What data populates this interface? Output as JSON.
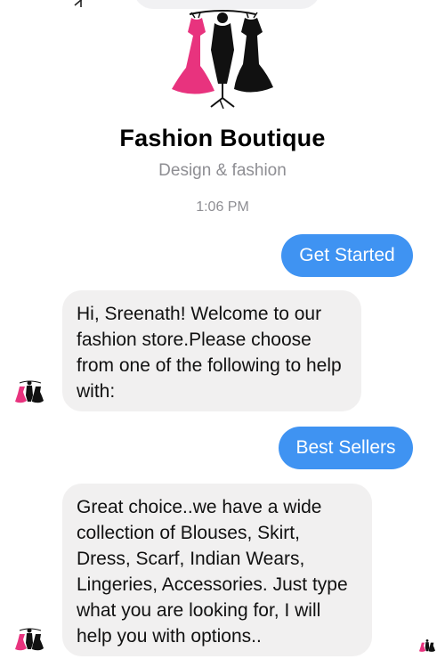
{
  "header": {
    "title": "Fashion Boutique",
    "subtitle": "Design & fashion"
  },
  "timestamp": "1:06 PM",
  "messages": [
    {
      "from": "user",
      "text": "Get Started"
    },
    {
      "from": "bot",
      "text": "Hi, Sreenath! Welcome to our fashion store.Please choose from one of the following to help with:"
    },
    {
      "from": "user",
      "text": "Best Sellers"
    },
    {
      "from": "bot",
      "text": "Great choice..we have a wide collection of Blouses, Skirt, Dress, Scarf, Indian Wears, Lingeries, Accessories. Just type what you are looking for, I will help you with options.."
    }
  ],
  "icons": {
    "brand_logo": "boutique-dress-logo",
    "bot_avatar": "boutique-dress-avatar",
    "seen_receipt": "boutique-dress-avatar"
  },
  "colors": {
    "outgoing_bubble": "#3f93f2",
    "incoming_bubble": "#f1f0f0",
    "dress_pink": "#e8337e",
    "dress_black": "#111111",
    "muted_text": "#8e8e93"
  }
}
